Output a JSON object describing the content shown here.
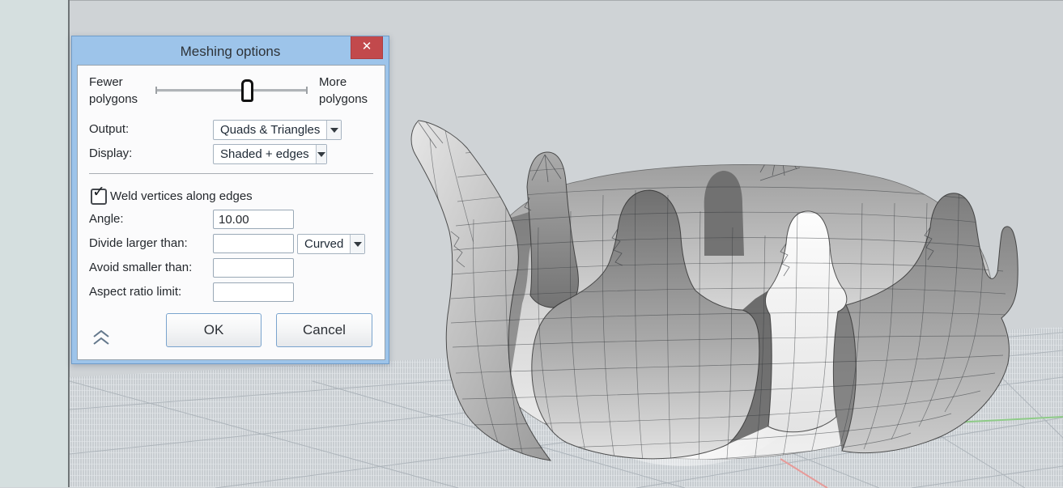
{
  "icons": {
    "close": "✕",
    "check": "✓"
  },
  "colors": {
    "dialog_frame": "#9dc4ea",
    "close_button": "#c2494c",
    "content_bg": "#fbfbfc",
    "axis_green": "#8fcb88",
    "axis_red": "#e79b99",
    "viewport_bg": "#cfd3d6"
  },
  "dialog": {
    "title": "Meshing options",
    "slider": {
      "left_label": "Fewer polygons",
      "right_label": "More polygons",
      "position_percent": 60
    },
    "rows": {
      "output": {
        "label": "Output:",
        "value": "Quads & Triangles"
      },
      "display": {
        "label": "Display:",
        "value": "Shaded + edges"
      },
      "weld": {
        "label": "Weld vertices along edges",
        "checked": true
      },
      "angle": {
        "label": "Angle:",
        "value": "10.00"
      },
      "divide": {
        "label": "Divide larger than:",
        "value": "",
        "option": "Curved"
      },
      "avoid": {
        "label": "Avoid smaller than:",
        "value": ""
      },
      "aspect": {
        "label": "Aspect ratio limit:",
        "value": ""
      }
    },
    "buttons": {
      "ok": "OK",
      "cancel": "Cancel"
    }
  }
}
